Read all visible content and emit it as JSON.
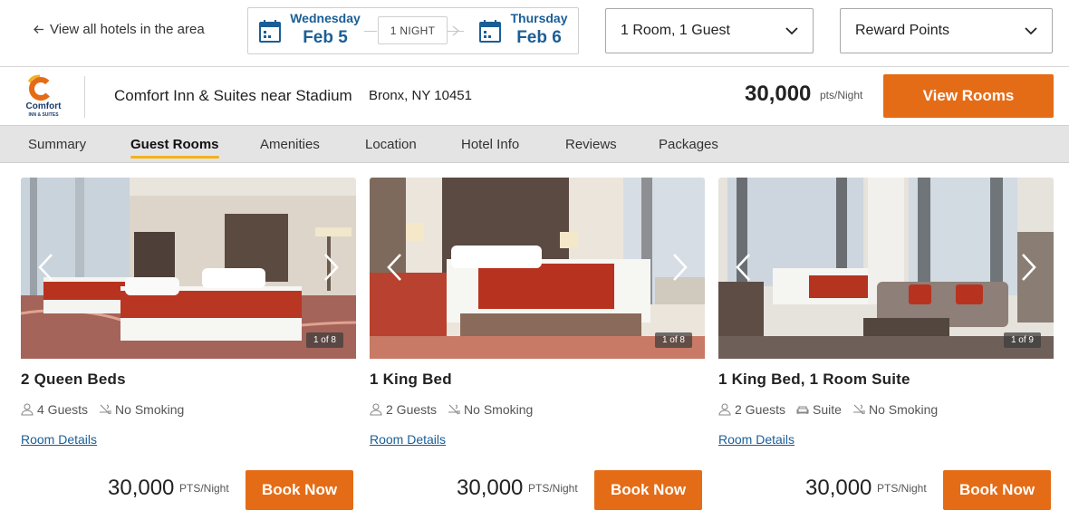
{
  "search": {
    "back_link": "View all hotels in the area",
    "checkin": {
      "dow": "Wednesday",
      "date": "Feb 5"
    },
    "checkout": {
      "dow": "Thursday",
      "date": "Feb 6"
    },
    "nights": "1 NIGHT",
    "rooms_guests": "1 Room, 1 Guest",
    "rate_type": "Reward Points"
  },
  "hotel": {
    "name": "Comfort Inn & Suites near Stadium",
    "address": "Bronx, NY 10451",
    "price": "30,000",
    "price_unit": "pts/Night",
    "cta": "View Rooms",
    "brand_logo": "comfort-logo",
    "brand_color": "#e56c17"
  },
  "tabs": [
    {
      "label": "Summary"
    },
    {
      "label": "Guest Rooms"
    },
    {
      "label": "Amenities"
    },
    {
      "label": "Location"
    },
    {
      "label": "Hotel Info"
    },
    {
      "label": "Reviews"
    },
    {
      "label": "Packages"
    }
  ],
  "active_tab": "Guest Rooms",
  "rooms": [
    {
      "title": "2 Queen Beds",
      "photo_counter": "1 of 8",
      "features": [
        "4 Guests",
        "No Smoking"
      ],
      "details_link": "Room Details",
      "price": "30,000",
      "price_unit": "PTS/Night",
      "cta": "Book Now"
    },
    {
      "title": "1 King Bed",
      "photo_counter": "1 of 8",
      "features": [
        "2 Guests",
        "No Smoking"
      ],
      "details_link": "Room Details",
      "price": "30,000",
      "price_unit": "PTS/Night",
      "cta": "Book Now"
    },
    {
      "title": "1 King Bed, 1 Room Suite",
      "photo_counter": "1 of 9",
      "features": [
        "2 Guests",
        "Suite",
        "No Smoking"
      ],
      "details_link": "Room Details",
      "price": "30,000",
      "price_unit": "PTS/Night",
      "cta": "Book Now"
    }
  ],
  "colors": {
    "accent": "#e56c17",
    "link": "#1b5e96",
    "tab_underline": "#f3b21b"
  }
}
